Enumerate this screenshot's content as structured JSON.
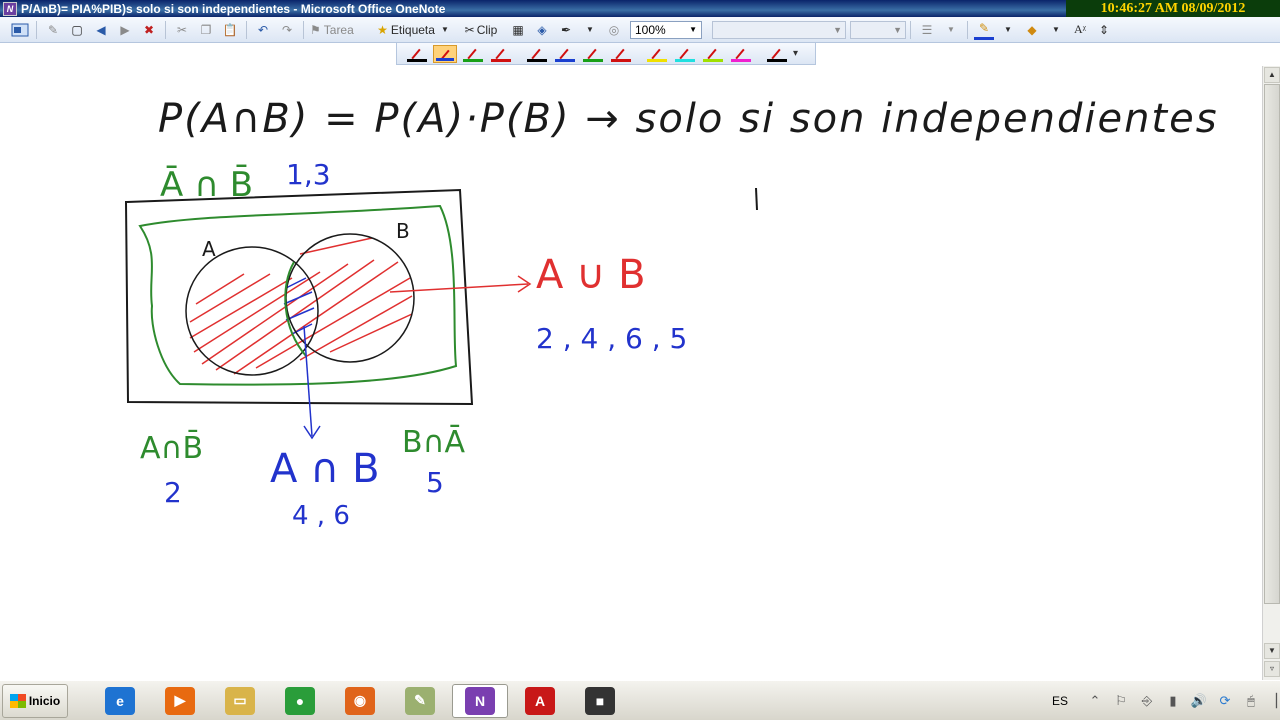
{
  "window": {
    "title": "P/AnB)= PIA%PIB)s solo si son independientes - Microsoft Office OneNote",
    "app_icon_letter": "N"
  },
  "overlay_clock": "10:46:27 AM 08/09/2012",
  "toolbar": {
    "tarea_label": "Tarea",
    "etiqueta_label": "Etiqueta",
    "clip_label": "Clip",
    "zoom_value": "100%"
  },
  "pen_toolbar": {
    "pens": [
      {
        "stroke": "#d01010",
        "bar": "#000000",
        "selected": false
      },
      {
        "stroke": "#d01010",
        "bar": "#1a3fd0",
        "selected": true
      },
      {
        "stroke": "#d01010",
        "bar": "#18a018",
        "selected": false
      },
      {
        "stroke": "#d01010",
        "bar": "#d01010",
        "selected": false
      },
      {
        "stroke": "#d01010",
        "bar": "#000000",
        "selected": false
      },
      {
        "stroke": "#d01010",
        "bar": "#1a3fd0",
        "selected": false
      },
      {
        "stroke": "#d01010",
        "bar": "#18a018",
        "selected": false
      },
      {
        "stroke": "#d01010",
        "bar": "#d01010",
        "selected": false
      },
      {
        "stroke": "#d01010",
        "bar": "#f0e000",
        "selected": false
      },
      {
        "stroke": "#d01010",
        "bar": "#20e0e0",
        "selected": false
      },
      {
        "stroke": "#d01010",
        "bar": "#a0e000",
        "selected": false
      },
      {
        "stroke": "#d01010",
        "bar": "#f020d0",
        "selected": false
      },
      {
        "stroke": "#d01010",
        "bar": "#000000",
        "selected": false
      }
    ]
  },
  "handwriting": {
    "formula": "P(A∩B) = P(A)·P(B) → solo si son independientes",
    "complement_label": "Ā ∩ B̄",
    "complement_values": "1,3",
    "set_a_label": "A",
    "set_b_label": "B",
    "union_label": "A ∪ B",
    "union_values": "2 , 4 , 6 , 5",
    "a_not_b_label": "A∩B̄",
    "a_not_b_value": "2",
    "intersection_label": "A ∩ B",
    "intersection_values": "4 , 6",
    "b_not_a_label": "B∩Ā",
    "b_not_a_value": "5",
    "colors": {
      "black": "#1a1a1a",
      "green": "#2e8b2e",
      "blue": "#2233cc",
      "red": "#e03030"
    }
  },
  "taskbar": {
    "start_label": "Inicio",
    "apps": [
      {
        "name": "internet-explorer",
        "glyph": "e",
        "color": "#1e73d2"
      },
      {
        "name": "media-player",
        "glyph": "▶",
        "color": "#e86a10"
      },
      {
        "name": "file-explorer",
        "glyph": "▭",
        "color": "#d9b44a"
      },
      {
        "name": "chrome",
        "glyph": "●",
        "color": "#2a9d3a"
      },
      {
        "name": "firefox",
        "glyph": "◉",
        "color": "#e0641a"
      },
      {
        "name": "notes",
        "glyph": "✎",
        "color": "#9bb070"
      },
      {
        "name": "onenote",
        "glyph": "N",
        "color": "#7a3fb0"
      },
      {
        "name": "acrobat",
        "glyph": "A",
        "color": "#c81818"
      },
      {
        "name": "video-recorder",
        "glyph": "■",
        "color": "#333333"
      }
    ],
    "language": "ES"
  }
}
